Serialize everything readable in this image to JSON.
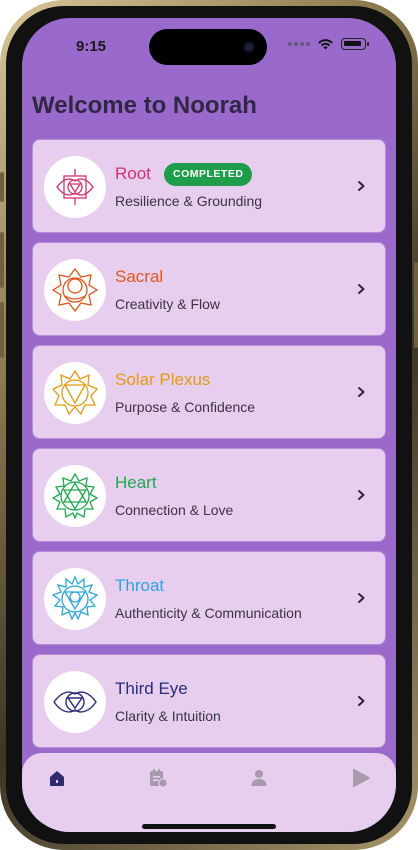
{
  "status_bar": {
    "time": "9:15"
  },
  "header": {
    "title": "Welcome to Noorah"
  },
  "chakras": [
    {
      "name": "Root",
      "subtitle": "Resilience & Grounding",
      "color": "#d4306f",
      "icon": "root-chakra-icon",
      "badge": "COMPLETED"
    },
    {
      "name": "Sacral",
      "subtitle": "Creativity & Flow",
      "color": "#e0561a",
      "icon": "sacral-chakra-icon"
    },
    {
      "name": "Solar Plexus",
      "subtitle": "Purpose & Confidence",
      "color": "#e49a12",
      "icon": "solar-plexus-chakra-icon"
    },
    {
      "name": "Heart",
      "subtitle": "Connection & Love",
      "color": "#1da84e",
      "icon": "heart-chakra-icon"
    },
    {
      "name": "Throat",
      "subtitle": "Authenticity & Communication",
      "color": "#2aa6dd",
      "icon": "throat-chakra-icon"
    },
    {
      "name": "Third Eye",
      "subtitle": "Clarity & Intuition",
      "color": "#2a2d7a",
      "icon": "third-eye-chakra-icon"
    }
  ],
  "tab_bar": {
    "tabs": [
      {
        "icon": "home-icon",
        "active": true
      },
      {
        "icon": "journal-icon",
        "active": false
      },
      {
        "icon": "profile-icon",
        "active": false
      },
      {
        "icon": "play-icon",
        "active": false
      }
    ],
    "active_color": "#2f2a6b",
    "inactive_color": "#a89aad"
  }
}
